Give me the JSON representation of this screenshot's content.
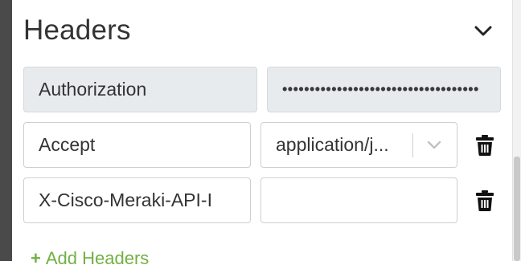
{
  "section": {
    "title": "Headers",
    "collapse_icon": "chevron-down-icon"
  },
  "headers": [
    {
      "key": "Authorization",
      "value": "••••••••••••••••••••••••••••••••••••",
      "readonly": true
    },
    {
      "key": "Accept",
      "value": "application/j...",
      "value_control": "select"
    },
    {
      "key": "X-Cisco-Meraki-API-I",
      "value": ""
    }
  ],
  "actions": {
    "delete_icon": "trash-icon",
    "add_label": "Add Headers",
    "add_icon": "plus-icon"
  },
  "colors": {
    "accent_green": "#72b043",
    "readonly_bg": "#e8ebee",
    "text": "#333333"
  }
}
